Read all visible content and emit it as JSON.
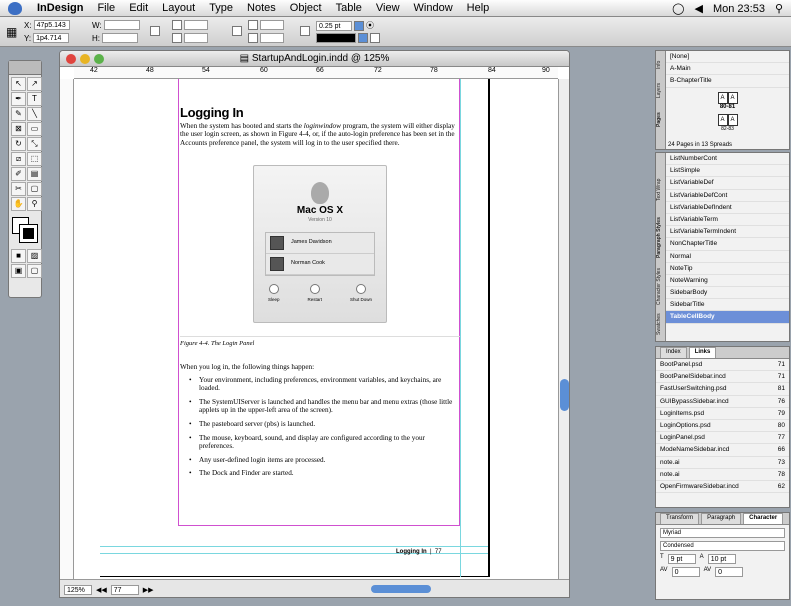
{
  "menubar": {
    "app": "InDesign",
    "items": [
      "File",
      "Edit",
      "Layout",
      "Type",
      "Notes",
      "Object",
      "Table",
      "View",
      "Window",
      "Help"
    ],
    "clock": "Mon 23:53"
  },
  "control": {
    "x_label": "X:",
    "x_value": "47p5.143",
    "y_label": "Y:",
    "y_value": "1p4.714",
    "w_label": "W:",
    "h_label": "H:",
    "stroke_value": "0.25 pt"
  },
  "document": {
    "title": "StartupAndLogin.indd @ 125%",
    "ruler_ticks": [
      "42",
      "48",
      "54",
      "60",
      "66",
      "72",
      "78",
      "84",
      "90"
    ],
    "heading": "Logging In",
    "intro_before": "When the system has booted and starts the ",
    "intro_italic": "loginwindow",
    "intro_after": " program, the system will either display the user login screen, as shown in Figure 4-4, or, if the auto-login preference has been set in the Accounts preference panel, the system will log in to the user specified there.",
    "figure": {
      "os_name": "Mac OS X",
      "os_sub": "Version 10",
      "users": [
        "James Davidson",
        "Norman Cook"
      ],
      "buttons": [
        "Sleep",
        "Restart",
        "Shut Down"
      ],
      "caption": "Figure 4-4. The Login Panel"
    },
    "body_lead": "When you log in, the following things happen:",
    "bullets": [
      "Your environment, including preferences, environment variables, and keychains, are loaded.",
      "The SystemUIServer is launched and handles the menu bar and menu extras (those little applets up in the upper-left area of the screen).",
      "The pasteboard server (pbs) is launched.",
      "The mouse, keyboard, sound, and display are configured according to the your preferences.",
      "Any user-defined login items are processed.",
      "The Dock and Finder are started."
    ],
    "footer_label": "Logging In",
    "footer_page": "77",
    "zoom": "125%",
    "page_field": "77"
  },
  "pages_panel": {
    "masters": [
      "[None]",
      "A-Main",
      "B-ChapterTitle"
    ],
    "spread_label": "80-81",
    "spread_small": "82-83",
    "status": "24 Pages in 13 Spreads",
    "tabs": [
      "Info",
      "Layers",
      "Pages"
    ]
  },
  "styles_panel": {
    "tabs": [
      "Text Wrap",
      "Paragraph Styles",
      "Character Styles",
      "Swatches"
    ],
    "items": [
      "ListNumberCont",
      "ListSimple",
      "ListVariableDef",
      "ListVariableDefCont",
      "ListVariableDefIndent",
      "ListVariableTerm",
      "ListVariableTermIndent",
      "NonChapterTitle",
      "Normal",
      "NoteTip",
      "NoteWarning",
      "SidebarBody",
      "SidebarTitle",
      "TableCellBody"
    ],
    "selected_index": 13
  },
  "links_panel": {
    "tabs": [
      "Index",
      "Links"
    ],
    "items": [
      {
        "name": "BootPanel.psd",
        "page": "71"
      },
      {
        "name": "BootPanelSidebar.incd",
        "page": "71"
      },
      {
        "name": "FastUserSwitching.psd",
        "page": "81"
      },
      {
        "name": "GUIBypassSidebar.incd",
        "page": "76"
      },
      {
        "name": "LoginItems.psd",
        "page": "79"
      },
      {
        "name": "LoginOptions.psd",
        "page": "80"
      },
      {
        "name": "LoginPanel.psd",
        "page": "77"
      },
      {
        "name": "ModeNameSidebar.incd",
        "page": "66"
      },
      {
        "name": "note.ai",
        "page": "73"
      },
      {
        "name": "note.ai",
        "page": "78"
      },
      {
        "name": "OpenFirmwareSidebar.incd",
        "page": "62"
      }
    ]
  },
  "char_panel": {
    "tabs": [
      "Transform",
      "Paragraph",
      "Character"
    ],
    "font": "Myriad",
    "style": "Condensed",
    "size": "9 pt",
    "leading": "10 pt",
    "kerning": "0",
    "tracking": "0"
  }
}
